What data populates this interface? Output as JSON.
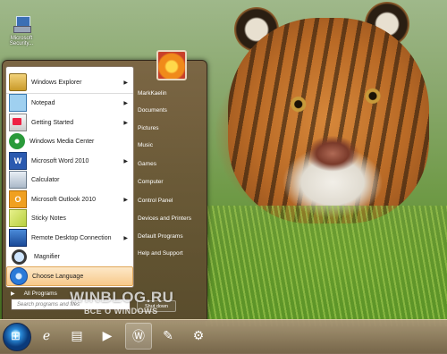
{
  "desktop": {
    "icon_label": "Microsoft Security..."
  },
  "start_menu": {
    "programs": [
      {
        "label": "Windows Explorer",
        "icon": "folder-icon",
        "submenu": true
      },
      {
        "label": "Notepad",
        "icon": "notepad-icon",
        "submenu": true
      },
      {
        "label": "Getting Started",
        "icon": "getting-started-icon",
        "submenu": true
      },
      {
        "label": "Windows Media Center",
        "icon": "media-center-icon",
        "submenu": false
      },
      {
        "label": "Microsoft Word 2010",
        "icon": "word-icon",
        "submenu": true
      },
      {
        "label": "Calculator",
        "icon": "calculator-icon",
        "submenu": false
      },
      {
        "label": "Microsoft Outlook 2010",
        "icon": "outlook-icon",
        "submenu": true
      },
      {
        "label": "Sticky Notes",
        "icon": "sticky-notes-icon",
        "submenu": false
      },
      {
        "label": "Remote Desktop Connection",
        "icon": "remote-desktop-icon",
        "submenu": true
      },
      {
        "label": "Magnifier",
        "icon": "magnifier-icon",
        "submenu": false
      },
      {
        "label": "Choose Language",
        "icon": "language-icon",
        "submenu": false
      }
    ],
    "all_programs": "All Programs",
    "search_placeholder": "Search programs and files",
    "right_items": [
      "MarkKaelin",
      "Documents",
      "Pictures",
      "Music",
      "Games",
      "Computer",
      "Control Panel",
      "Devices and Printers",
      "Default Programs",
      "Help and Support"
    ],
    "shutdown_label": "Shut down"
  },
  "taskbar": {
    "buttons": [
      "ie-icon",
      "explorer-icon",
      "media-player-icon",
      "warcraft-icon",
      "paint-icon",
      "network-icon"
    ]
  },
  "watermark": {
    "line1": "WINBLOG.RU",
    "line2": "ВСЁ О WINDOWS"
  },
  "colors": {
    "highlight": "#f7c98a",
    "menu_bg": "#7a5a3c",
    "taskbar": "#a08a6a"
  }
}
